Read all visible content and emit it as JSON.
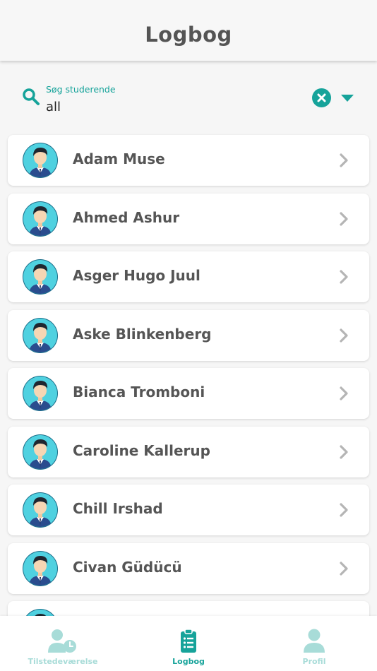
{
  "header": {
    "title": "Logbog"
  },
  "search": {
    "label": "Søg studerende",
    "value": "all",
    "icons": {
      "search": "search-icon",
      "clear": "clear-icon",
      "dropdown": "caret-down-icon"
    }
  },
  "students": [
    {
      "name": "Adam Muse"
    },
    {
      "name": "Ahmed Ashur"
    },
    {
      "name": "Asger Hugo Juul"
    },
    {
      "name": "Aske Blinkenberg"
    },
    {
      "name": "Bianca Tromboni"
    },
    {
      "name": "Caroline Kallerup"
    },
    {
      "name": "Chill Irshad"
    },
    {
      "name": "Civan Güdücü"
    },
    {
      "name": ""
    }
  ],
  "tabbar": {
    "tabs": [
      {
        "label": "Tilstedeværelse",
        "icon": "attendance-icon",
        "active": false
      },
      {
        "label": "Logbog",
        "icon": "logbook-icon",
        "active": true
      },
      {
        "label": "Profil",
        "icon": "profile-icon",
        "active": false
      }
    ]
  },
  "colors": {
    "accent": "#16a39a",
    "accent_light": "#a8dcd8",
    "text": "#555555",
    "avatar_bg": "#4fd1e0"
  }
}
